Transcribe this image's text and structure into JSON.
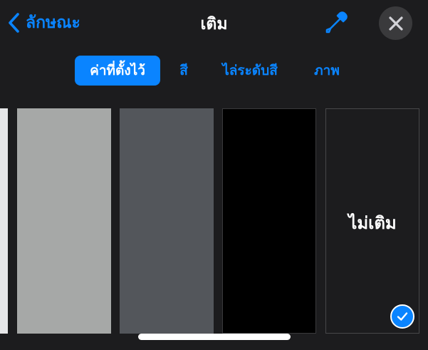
{
  "header": {
    "back_label": "ลักษณะ",
    "title": "เติม",
    "eyedropper_icon": "eyedropper-icon",
    "close_icon": "close-icon"
  },
  "tabs": [
    {
      "label": "ค่าที่ตั้งไว้",
      "selected": true
    },
    {
      "label": "สี",
      "selected": false
    },
    {
      "label": "ไล่ระดับสี",
      "selected": false
    },
    {
      "label": "ภาพ",
      "selected": false
    }
  ],
  "swatches": [
    {
      "kind": "color",
      "color": "#e6e7e8"
    },
    {
      "kind": "color",
      "color": "#a6a8a7"
    },
    {
      "kind": "color",
      "color": "#53565b"
    },
    {
      "kind": "color",
      "color": "#000000"
    },
    {
      "kind": "none",
      "label": "ไม่เติม",
      "selected": true
    }
  ],
  "colors": {
    "accent": "#0a84ff",
    "background": "#1c1c1e",
    "close_button_bg": "#3a3a3c"
  }
}
